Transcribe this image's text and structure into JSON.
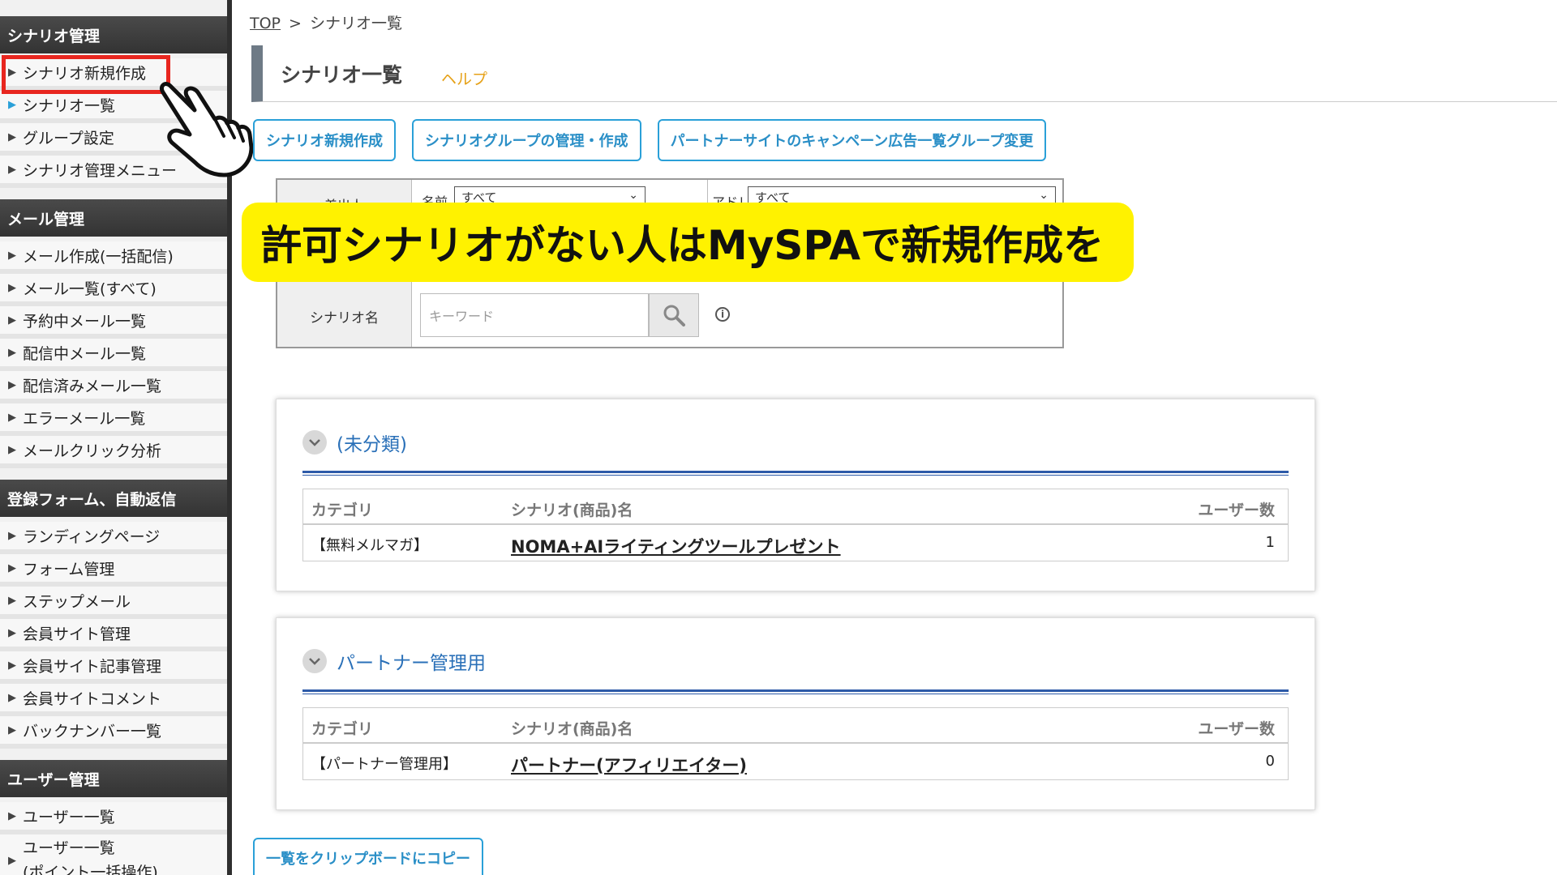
{
  "sidebar": {
    "sections": [
      {
        "title": "シナリオ管理",
        "items": [
          "シナリオ新規作成",
          "シナリオ一覧",
          "グループ設定",
          "シナリオ管理メニュー"
        ]
      },
      {
        "title": "メール管理",
        "items": [
          "メール作成(一括配信)",
          "メール一覧(すべて)",
          "予約中メール一覧",
          "配信中メール一覧",
          "配信済みメール一覧",
          "エラーメール一覧",
          "メールクリック分析"
        ]
      },
      {
        "title": "登録フォーム、自動返信",
        "items": [
          "ランディングページ",
          "フォーム管理",
          "ステップメール",
          "会員サイト管理",
          "会員サイト記事管理",
          "会員サイトコメント",
          "バックナンバー一覧"
        ]
      },
      {
        "title": "ユーザー管理",
        "items": [
          "ユーザー一覧",
          "ユーザー一覧",
          "(ポイント一括操作)"
        ]
      }
    ]
  },
  "breadcrumb": {
    "top": "TOP",
    "sep": ">",
    "current": "シナリオ一覧"
  },
  "page": {
    "title": "シナリオ一覧",
    "help": "ヘルプ"
  },
  "buttons": {
    "new_scenario": "シナリオ新規作成",
    "group_manage": "シナリオグループの管理・作成",
    "partner_change": "パートナーサイトのキャンペーン広告一覧グループ変更",
    "copy_clipboard": "一覧をクリップボードにコピー"
  },
  "filter": {
    "sender_label": "差出人",
    "name_label": "名前",
    "name_value": "すべて",
    "address_label": "アドレス",
    "address_value": "すべて",
    "scenario_label": "シナリオ名",
    "keyword_placeholder": "キーワード"
  },
  "banner": {
    "text": "許可シナリオがない人はMySPAで新規作成を"
  },
  "groups": [
    {
      "name": "(未分類)",
      "headers": {
        "category": "カテゴリ",
        "scenario": "シナリオ(商品)名",
        "users": "ユーザー数"
      },
      "row": {
        "category": "【無料メルマガ】",
        "scenario": "NOMA+AIライティングツールプレゼント",
        "users": "1"
      }
    },
    {
      "name": "パートナー管理用",
      "headers": {
        "category": "カテゴリ",
        "scenario": "シナリオ(商品)名",
        "users": "ユーザー数"
      },
      "row": {
        "category": "【パートナー管理用】",
        "scenario": "パートナー(アフィリエイター)",
        "users": "0"
      }
    }
  ],
  "colors": {
    "accent": "#2aa0d8",
    "banner": "#fff200",
    "highlight": "#e8261f",
    "help": "#e6a117"
  }
}
